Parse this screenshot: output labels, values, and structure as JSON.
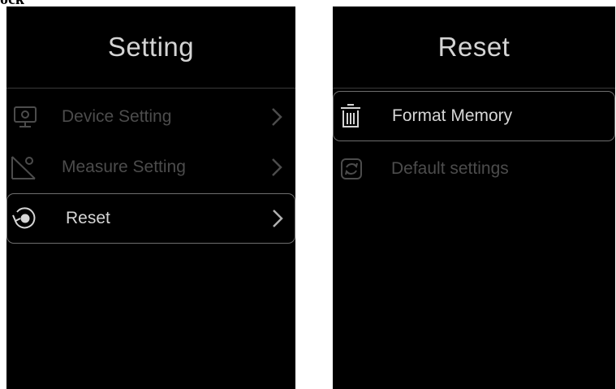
{
  "header_text": "ock",
  "left_screen": {
    "title": "Setting",
    "items": [
      {
        "label": "Device Setting",
        "icon": "monitor-icon",
        "chevron": "chevron-right-icon"
      },
      {
        "label": "Measure Setting",
        "icon": "protractor-icon",
        "chevron": "chevron-right-icon"
      },
      {
        "label": "Reset",
        "icon": "reset-icon",
        "chevron": "chevron-right-icon",
        "selected": true
      }
    ]
  },
  "right_screen": {
    "title": "Reset",
    "items": [
      {
        "label": "Format Memory",
        "icon": "trash-icon",
        "selected": true
      },
      {
        "label": "Default settings",
        "icon": "refresh-icon"
      }
    ]
  },
  "colors": {
    "screen_bg": "#000000",
    "text_bright": "#d6d6d6",
    "text_dim": "#4c4c4c",
    "selection_border": "#6e6e6e"
  }
}
